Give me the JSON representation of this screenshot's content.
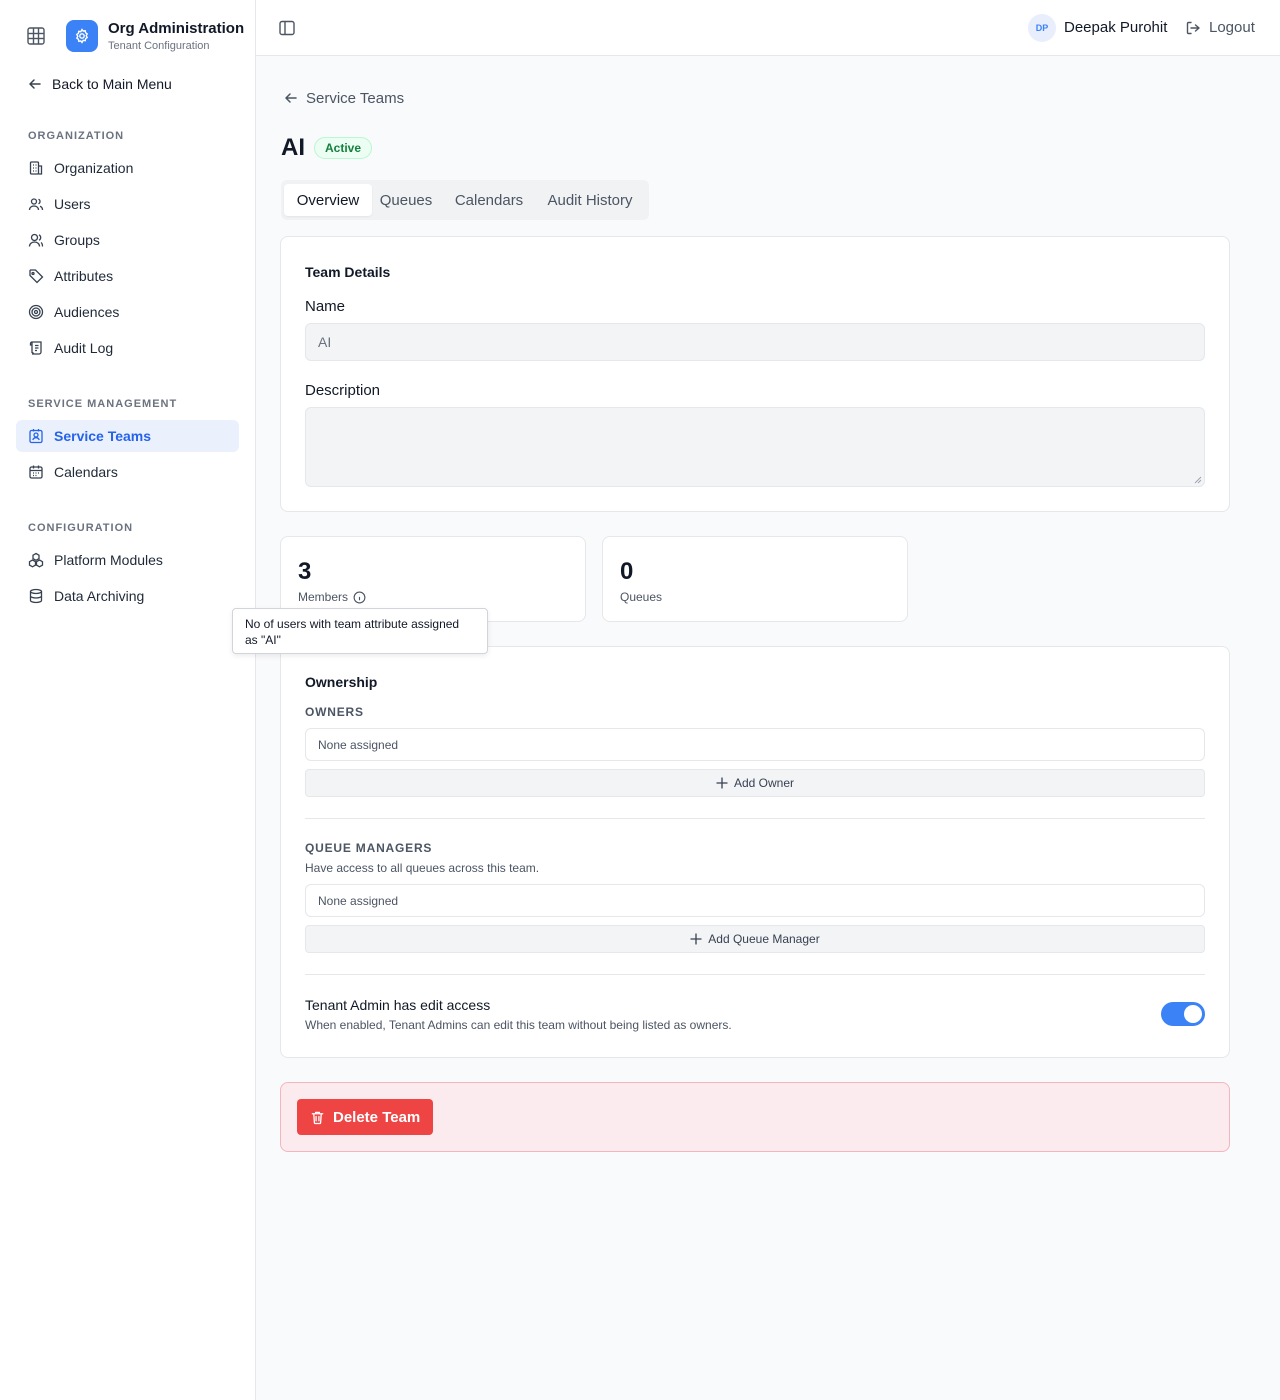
{
  "app": {
    "title": "Org Administration",
    "subtitle": "Tenant Configuration",
    "back_label": "Back to Main Menu",
    "accent_color": "#3b82f6"
  },
  "sidebar": {
    "sections": [
      {
        "label": "ORGANIZATION",
        "items": [
          {
            "label": "Organization",
            "icon": "building-icon"
          },
          {
            "label": "Users",
            "icon": "users-icon"
          },
          {
            "label": "Groups",
            "icon": "user-group-icon"
          },
          {
            "label": "Attributes",
            "icon": "tag-icon"
          },
          {
            "label": "Audiences",
            "icon": "target-icon"
          },
          {
            "label": "Audit Log",
            "icon": "scroll-icon"
          }
        ]
      },
      {
        "label": "SERVICE MANAGEMENT",
        "items": [
          {
            "label": "Service Teams",
            "icon": "contact-badge-icon",
            "active": true
          },
          {
            "label": "Calendars",
            "icon": "calendar-icon"
          }
        ]
      },
      {
        "label": "CONFIGURATION",
        "items": [
          {
            "label": "Platform Modules",
            "icon": "modules-icon"
          },
          {
            "label": "Data Archiving",
            "icon": "database-icon"
          }
        ]
      }
    ]
  },
  "topbar": {
    "user_initials": "DP",
    "user_name": "Deepak Purohit",
    "logout_label": "Logout"
  },
  "page": {
    "breadcrumb": "Service Teams",
    "title": "AI",
    "status": "Active",
    "status_color": "#15803d",
    "tabs": [
      {
        "label": "Overview",
        "active": true
      },
      {
        "label": "Queues"
      },
      {
        "label": "Calendars"
      },
      {
        "label": "Audit History"
      }
    ]
  },
  "team_details": {
    "title": "Team Details",
    "name_label": "Name",
    "name_value": "AI",
    "description_label": "Description",
    "description_value": ""
  },
  "stats": {
    "members_count": "3",
    "members_label": "Members",
    "queues_count": "0",
    "queues_label": "Queues",
    "tooltip": "No of users with team attribute assigned as \"AI\""
  },
  "ownership": {
    "title": "Ownership",
    "owners_label": "OWNERS",
    "owners_value": "None assigned",
    "add_owner_label": "Add Owner",
    "queue_managers_label": "QUEUE MANAGERS",
    "queue_managers_hint": "Have access to all queues across this team.",
    "queue_managers_value": "None assigned",
    "add_queue_manager_label": "Add Queue Manager",
    "tenant_admin_label": "Tenant Admin has edit access",
    "tenant_admin_hint": "When enabled, Tenant Admins can edit this team without being listed as owners.",
    "tenant_admin_enabled": true
  },
  "danger": {
    "delete_label": "Delete Team",
    "delete_color": "#ef4444"
  }
}
